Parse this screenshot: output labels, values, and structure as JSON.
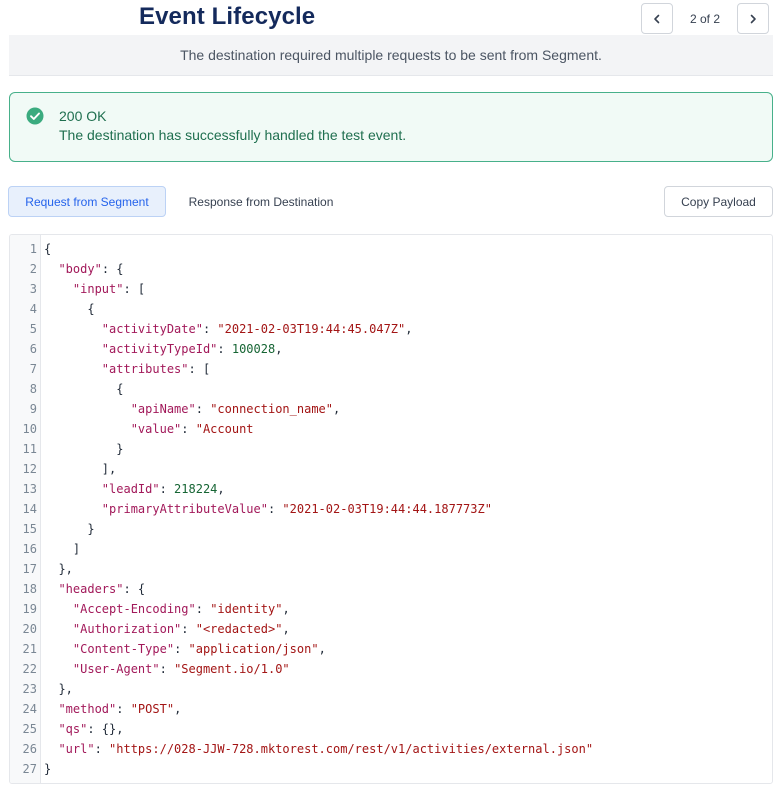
{
  "header": {
    "title": "Event Lifecycle",
    "pager_text": "2 of 2"
  },
  "banner": {
    "text": "The destination required multiple requests to be sent from Segment."
  },
  "alert": {
    "status": "200 OK",
    "message": "The destination has successfully handled the test event.",
    "icon": "check-circle-icon",
    "color": "#3bab7f"
  },
  "tabs": [
    {
      "label": "Request from Segment",
      "active": true
    },
    {
      "label": "Response from Destination",
      "active": false
    }
  ],
  "copy_label": "Copy Payload",
  "code": {
    "lines": [
      [
        [
          "p",
          "{"
        ]
      ],
      [
        [
          "p",
          "  "
        ],
        [
          "k",
          "\"body\""
        ],
        [
          "p",
          ": {"
        ]
      ],
      [
        [
          "p",
          "    "
        ],
        [
          "k",
          "\"input\""
        ],
        [
          "p",
          ": ["
        ]
      ],
      [
        [
          "p",
          "      {"
        ]
      ],
      [
        [
          "p",
          "        "
        ],
        [
          "k",
          "\"activityDate\""
        ],
        [
          "p",
          ": "
        ],
        [
          "s",
          "\"2021-02-03T19:44:45.047Z\""
        ],
        [
          "p",
          ","
        ]
      ],
      [
        [
          "p",
          "        "
        ],
        [
          "k",
          "\"activityTypeId\""
        ],
        [
          "p",
          ": "
        ],
        [
          "n",
          "100028"
        ],
        [
          "p",
          ","
        ]
      ],
      [
        [
          "p",
          "        "
        ],
        [
          "k",
          "\"attributes\""
        ],
        [
          "p",
          ": ["
        ]
      ],
      [
        [
          "p",
          "          {"
        ]
      ],
      [
        [
          "p",
          "            "
        ],
        [
          "k",
          "\"apiName\""
        ],
        [
          "p",
          ": "
        ],
        [
          "s",
          "\"connection_name\""
        ],
        [
          "p",
          ","
        ]
      ],
      [
        [
          "p",
          "            "
        ],
        [
          "k",
          "\"value\""
        ],
        [
          "p",
          ": "
        ],
        [
          "s",
          "\"Account"
        ]
      ],
      [
        [
          "p",
          "          }"
        ]
      ],
      [
        [
          "p",
          "        ],"
        ]
      ],
      [
        [
          "p",
          "        "
        ],
        [
          "k",
          "\"leadId\""
        ],
        [
          "p",
          ": "
        ],
        [
          "n",
          "218224"
        ],
        [
          "p",
          ","
        ]
      ],
      [
        [
          "p",
          "        "
        ],
        [
          "k",
          "\"primaryAttributeValue\""
        ],
        [
          "p",
          ": "
        ],
        [
          "s",
          "\"2021-02-03T19:44:44.187773Z\""
        ]
      ],
      [
        [
          "p",
          "      }"
        ]
      ],
      [
        [
          "p",
          "    ]"
        ]
      ],
      [
        [
          "p",
          "  },"
        ]
      ],
      [
        [
          "p",
          "  "
        ],
        [
          "k",
          "\"headers\""
        ],
        [
          "p",
          ": {"
        ]
      ],
      [
        [
          "p",
          "    "
        ],
        [
          "k",
          "\"Accept-Encoding\""
        ],
        [
          "p",
          ": "
        ],
        [
          "s",
          "\"identity\""
        ],
        [
          "p",
          ","
        ]
      ],
      [
        [
          "p",
          "    "
        ],
        [
          "k",
          "\"Authorization\""
        ],
        [
          "p",
          ": "
        ],
        [
          "s",
          "\"<redacted>\""
        ],
        [
          "p",
          ","
        ]
      ],
      [
        [
          "p",
          "    "
        ],
        [
          "k",
          "\"Content-Type\""
        ],
        [
          "p",
          ": "
        ],
        [
          "s",
          "\"application/json\""
        ],
        [
          "p",
          ","
        ]
      ],
      [
        [
          "p",
          "    "
        ],
        [
          "k",
          "\"User-Agent\""
        ],
        [
          "p",
          ": "
        ],
        [
          "s",
          "\"Segment.io/1.0\""
        ]
      ],
      [
        [
          "p",
          "  },"
        ]
      ],
      [
        [
          "p",
          "  "
        ],
        [
          "k",
          "\"method\""
        ],
        [
          "p",
          ": "
        ],
        [
          "s",
          "\"POST\""
        ],
        [
          "p",
          ","
        ]
      ],
      [
        [
          "p",
          "  "
        ],
        [
          "k",
          "\"qs\""
        ],
        [
          "p",
          ": {},"
        ]
      ],
      [
        [
          "p",
          "  "
        ],
        [
          "k",
          "\"url\""
        ],
        [
          "p",
          ": "
        ],
        [
          "s",
          "\"https://028-JJW-728.mktorest.com/rest/v1/activities/external.json\""
        ]
      ],
      [
        [
          "p",
          "}"
        ]
      ]
    ]
  }
}
